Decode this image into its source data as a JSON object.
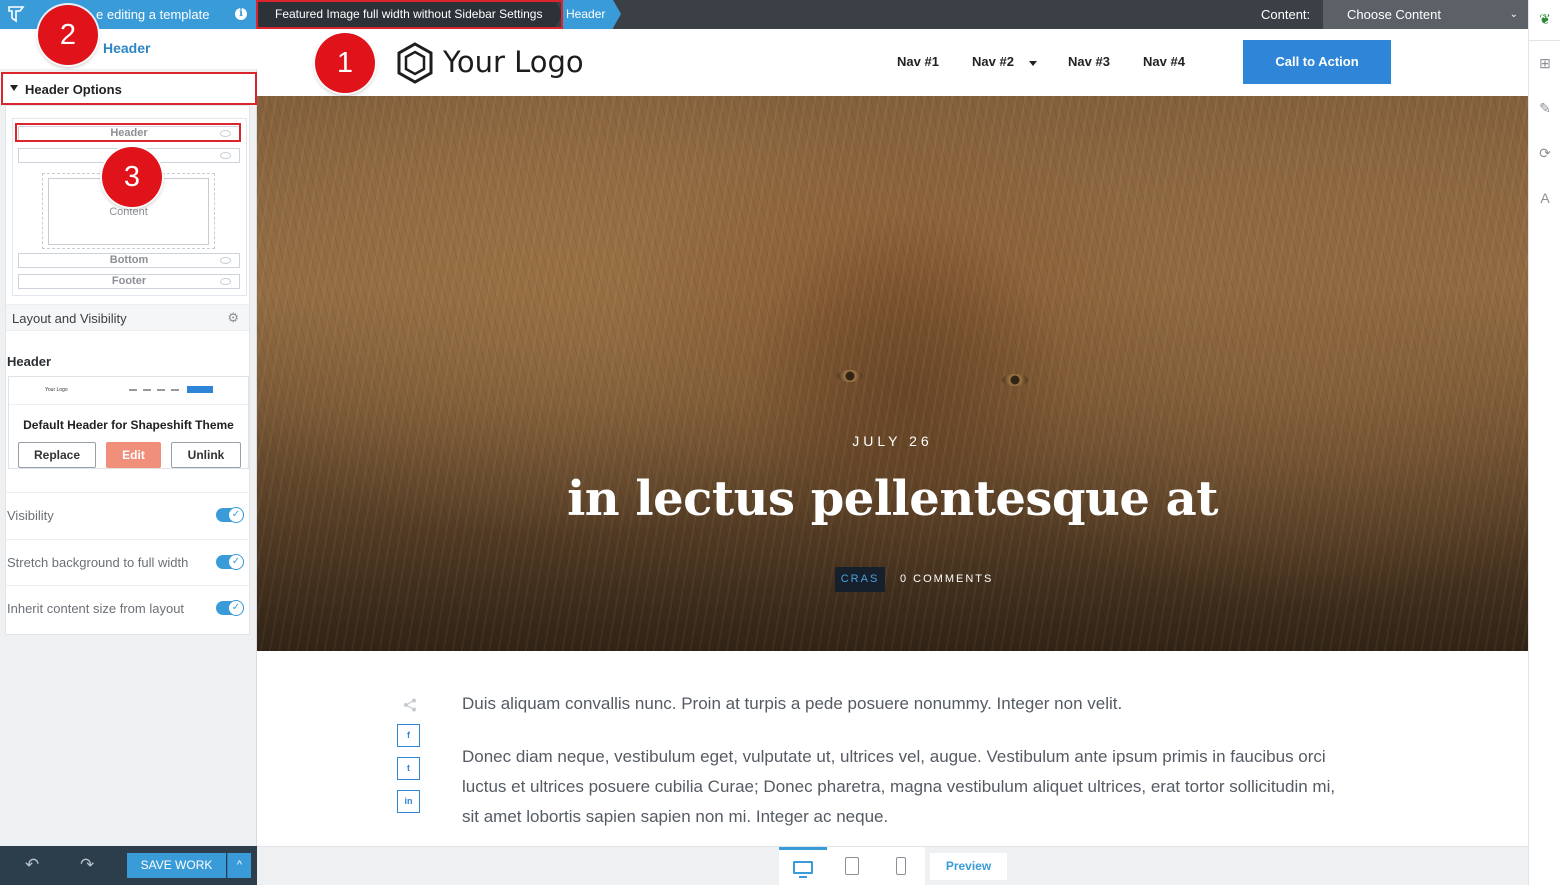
{
  "sidebar": {
    "mode_text": "e editing a template",
    "back_arrow": "‹",
    "title": "Header",
    "section_title": "Header Options",
    "layout_map": {
      "header": "Header",
      "top": "",
      "content": "Content",
      "bottom": "Bottom",
      "footer": "Footer"
    },
    "layout_visibility": "Layout and Visibility",
    "header_label": "Header",
    "header_card": {
      "thumb_logo": "Your Logo",
      "name": "Default Header for Shapeshift Theme",
      "replace": "Replace",
      "edit": "Edit",
      "unlink": "Unlink"
    },
    "toggles": [
      {
        "label": "Visibility",
        "on": true
      },
      {
        "label": "Stretch background to full width",
        "on": true
      },
      {
        "label": "Inherit content size from layout",
        "on": true
      }
    ],
    "footer": {
      "undo": "↶",
      "redo": "↷",
      "save": "SAVE WORK",
      "save_more": "^"
    }
  },
  "topbar": {
    "breadcrumb_template": "Featured Image full width without Sidebar Settings",
    "breadcrumb_current": "Header",
    "content_label": "Content:",
    "content_select": "Choose Content",
    "content_chevron": "⌄"
  },
  "site": {
    "logo_text": "Your Logo",
    "nav": [
      "Nav #1",
      "Nav #2",
      "Nav #3",
      "Nav #4"
    ],
    "cta": "Call to Action"
  },
  "hero": {
    "date": "JULY 26",
    "title": "in lectus pellentesque at",
    "category": "CRAS",
    "comments": "0 COMMENTS"
  },
  "article": {
    "share_icon": "share",
    "social": [
      "f",
      "t",
      "in"
    ],
    "paragraphs": [
      "Duis aliquam convallis nunc. Proin at turpis a pede posuere nonummy. Integer non velit.",
      "Donec diam neque, vestibulum eget, vulputate ut, ultrices vel, augue. Vestibulum ante ipsum primis in faucibus orci luctus et ultrices posuere cubilia Curae; Donec pharetra, magna vestibulum aliquet ultrices, erat tortor sollicitudin mi, sit amet lobortis sapien sapien non mi. Integer ac neque."
    ]
  },
  "device_bar": {
    "preview": "Preview"
  },
  "rail": {
    "icons": [
      "leaf-icon",
      "add-element-icon",
      "brush-icon",
      "sync-icon",
      "typography-icon"
    ]
  },
  "annotations": {
    "badge_1": "1",
    "badge_2": "2",
    "badge_3": "3",
    "annotation_color": "#d9252b"
  },
  "colors": {
    "accent": "#3a9bd9",
    "cta": "#2f86d8",
    "edit_button": "#f0907a",
    "topbar": "#3a4045",
    "footer_dark": "#2c3d4b"
  }
}
